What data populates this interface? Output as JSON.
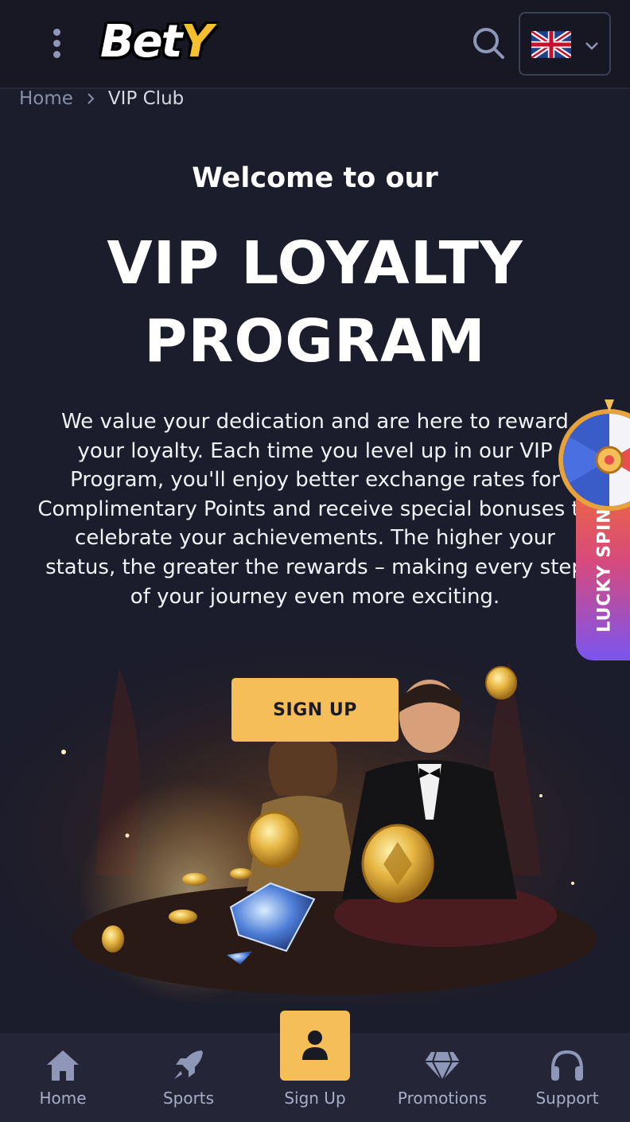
{
  "header": {
    "logo_text_main": "Bet",
    "logo_text_accent": "Y",
    "language": "English"
  },
  "breadcrumb": {
    "home": "Home",
    "current": "VIP Club"
  },
  "hero": {
    "welcome": "Welcome to our",
    "title_line1": "VIP LOYALTY",
    "title_line2": "PROGRAM",
    "intro": "We value your dedication and are here to reward your loyalty. Each time you level up in our VIP Program, you'll enjoy better exchange rates for Complimentary Points and receive special bonuses to celebrate your achievements. The higher your status, the greater the rewards – making every step of your journey even more exciting.",
    "cta_label": "SIGN UP"
  },
  "lucky_spin": {
    "label": "LUCKY SPIN"
  },
  "bottom_nav": {
    "items": [
      {
        "label": "Home",
        "icon": "home-icon"
      },
      {
        "label": "Sports",
        "icon": "rocket-icon"
      },
      {
        "label": "Sign Up",
        "icon": "user-icon"
      },
      {
        "label": "Promotions",
        "icon": "diamond-icon"
      },
      {
        "label": "Support",
        "icon": "headset-icon"
      }
    ]
  },
  "colors": {
    "background": "#1b1c2c",
    "header": "#171823",
    "accent": "#f6be58",
    "nav": "#242637",
    "muted": "#a8aec8"
  }
}
